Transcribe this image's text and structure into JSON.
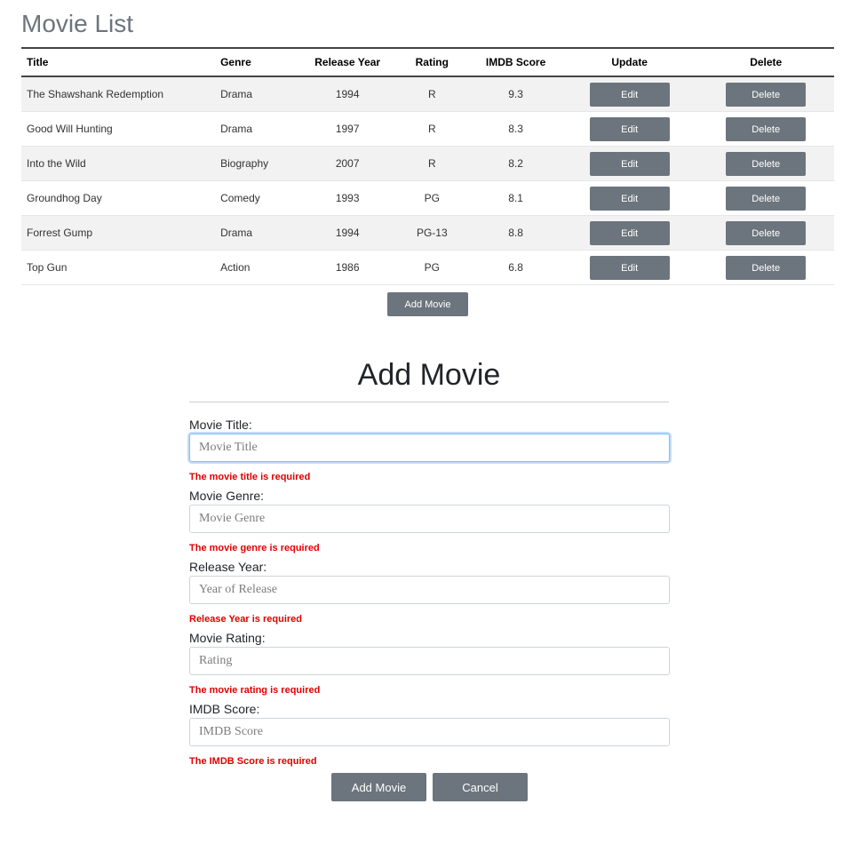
{
  "list": {
    "title": "Movie List",
    "columns": {
      "title": "Title",
      "genre": "Genre",
      "year": "Release Year",
      "rating": "Rating",
      "score": "IMDB Score",
      "update": "Update",
      "delete": "Delete"
    },
    "movies": [
      {
        "title": "The Shawshank Redemption",
        "genre": "Drama",
        "year": "1994",
        "rating": "R",
        "score": "9.3",
        "edit_label": "Edit",
        "delete_label": "Delete"
      },
      {
        "title": "Good Will Hunting",
        "genre": "Drama",
        "year": "1997",
        "rating": "R",
        "score": "8.3",
        "edit_label": "Edit",
        "delete_label": "Delete"
      },
      {
        "title": "Into the Wild",
        "genre": "Biography",
        "year": "2007",
        "rating": "R",
        "score": "8.2",
        "edit_label": "Edit",
        "delete_label": "Delete"
      },
      {
        "title": "Groundhog Day",
        "genre": "Comedy",
        "year": "1993",
        "rating": "PG",
        "score": "8.1",
        "edit_label": "Edit",
        "delete_label": "Delete"
      },
      {
        "title": "Forrest Gump",
        "genre": "Drama",
        "year": "1994",
        "rating": "PG-13",
        "score": "8.8",
        "edit_label": "Edit",
        "delete_label": "Delete"
      },
      {
        "title": "Top Gun",
        "genre": "Action",
        "year": "1986",
        "rating": "PG",
        "score": "6.8",
        "edit_label": "Edit",
        "delete_label": "Delete"
      }
    ],
    "add_button_label": "Add Movie"
  },
  "form": {
    "heading": "Add Movie",
    "fields": {
      "title": {
        "label": "Movie Title:",
        "placeholder": "Movie Title",
        "value": "",
        "error": "The movie title is required"
      },
      "genre": {
        "label": "Movie Genre:",
        "placeholder": "Movie Genre",
        "value": "",
        "error": "The movie genre is required"
      },
      "year": {
        "label": "Release Year:",
        "placeholder": "Year of Release",
        "value": "",
        "error": "Release Year is required"
      },
      "rating": {
        "label": "Movie Rating:",
        "placeholder": "Rating",
        "value": "",
        "error": "The movie rating is required"
      },
      "score": {
        "label": "IMDB Score:",
        "placeholder": "IMDB Score",
        "value": "",
        "error": "The IMDB Score is required"
      }
    },
    "submit_label": "Add Movie",
    "cancel_label": "Cancel"
  },
  "colors": {
    "button_gray": "#6c757d",
    "error_red": "#e00000",
    "focus_blue": "#80bdff",
    "stripe": "#f2f2f2"
  }
}
